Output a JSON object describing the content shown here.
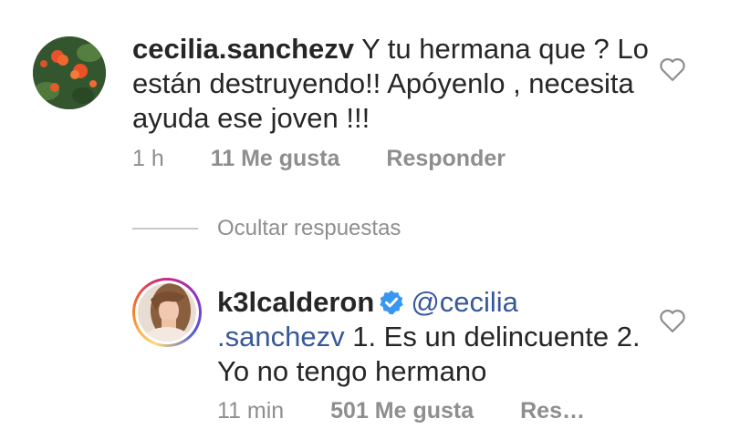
{
  "comments": [
    {
      "username": "cecilia.sanchezv",
      "text": "Y tu hermana que ? Lo están destruyendo!! Apóyenlo , necesita ayuda ese joven !!!",
      "time": "1 h",
      "likes": "11 Me gusta",
      "reply_label": "Responder",
      "avatar": "flowers-avatar"
    }
  ],
  "replies_toggle": {
    "label": "Ocultar respuestas"
  },
  "reply": {
    "username": "k3lcalderon",
    "verified": true,
    "mention_part1": "@cecilia",
    "mention_part2": ".sanchezv",
    "text": "1. Es un delincuente 2. Yo no tengo hermano",
    "time": "11 min",
    "likes": "501 Me gusta",
    "reply_label": "Res…",
    "avatar": "woman-portrait-avatar"
  },
  "colors": {
    "text": "#262626",
    "secondary": "#8e8e8e",
    "mention": "#385898",
    "verified": "#3897f0"
  }
}
